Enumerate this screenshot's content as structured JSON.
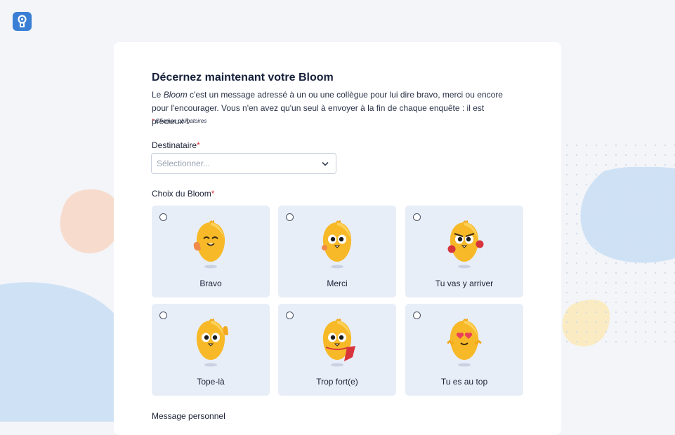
{
  "form": {
    "title": "Décernez maintenant votre Bloom",
    "intro_prefix": "Le ",
    "intro_em": "Bloom",
    "intro_suffix": " c'est un message adressé à un ou une collègue pour lui dire bravo, merci ou encore pour l'encourager. Vous n'en avez qu'un seul à envoyer à la fin de chaque enquête : il est précieux !",
    "required_star": "*",
    "required_note": "Champs obligatoires",
    "recipient_label": "Destinataire",
    "recipient_placeholder": "Sélectionner...",
    "choice_label": "Choix du Bloom",
    "message_label": "Message personnel"
  },
  "options": [
    {
      "label": "Bravo",
      "variant": "bravo"
    },
    {
      "label": "Merci",
      "variant": "merci"
    },
    {
      "label": "Tu vas y arriver",
      "variant": "gloves"
    },
    {
      "label": "Tope-là",
      "variant": "highfive"
    },
    {
      "label": "Trop fort(e)",
      "variant": "cape"
    },
    {
      "label": "Tu es au top",
      "variant": "hearts"
    }
  ],
  "colors": {
    "accent": "#3a7fd5",
    "required": "#e0343c",
    "card_option": "#e8eef7",
    "mascot": "#f7b928"
  }
}
